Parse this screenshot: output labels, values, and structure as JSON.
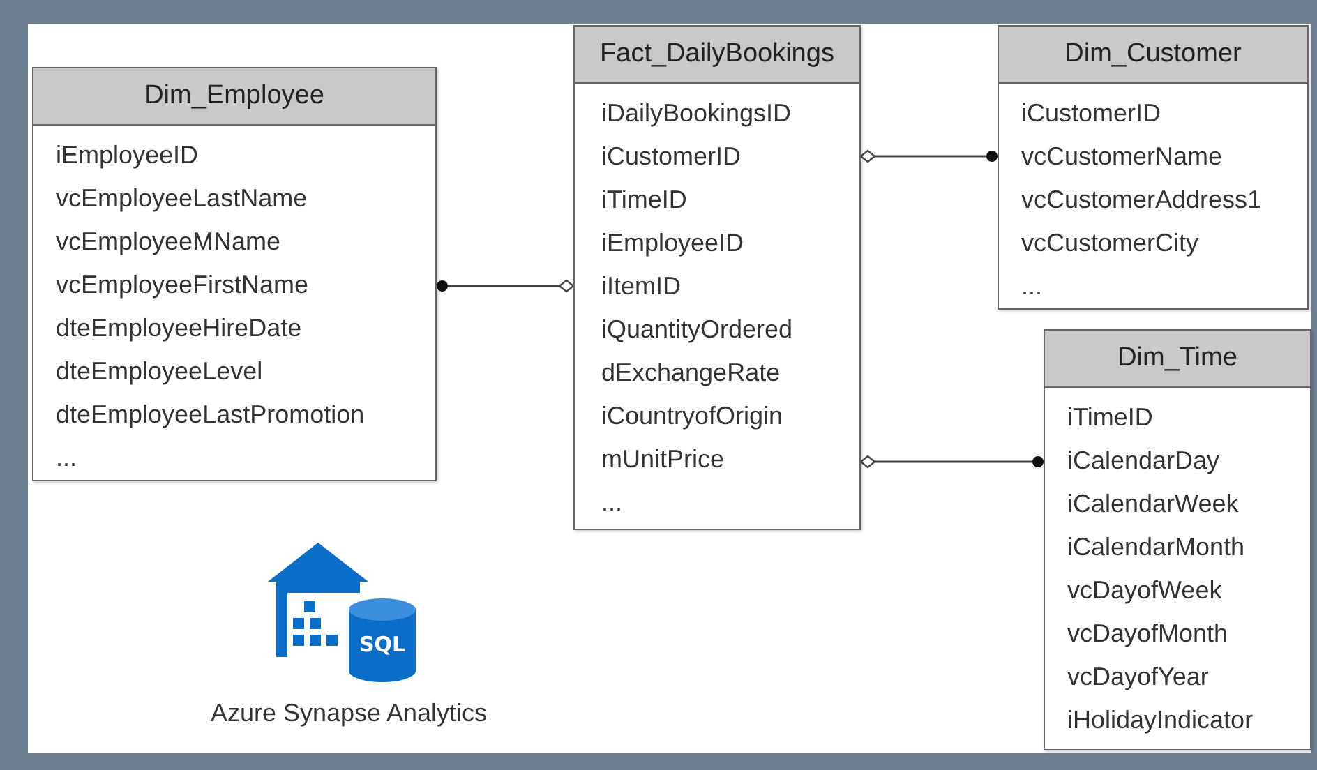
{
  "tables": [
    {
      "name": "Dim_Employee",
      "fields": [
        "iEmployeeID",
        "vcEmployeeLastName",
        "vcEmployeeMName",
        "vcEmployeeFirstName",
        "dteEmployeeHireDate",
        "dteEmployeeLevel",
        "dteEmployeeLastPromotion",
        "..."
      ]
    },
    {
      "name": "Fact_DailyBookings",
      "fields": [
        "iDailyBookingsID",
        "iCustomerID",
        "iTimeID",
        "iEmployeeID",
        "iItemID",
        "iQuantityOrdered",
        "dExchangeRate",
        "iCountryofOrigin",
        "mUnitPrice",
        "..."
      ]
    },
    {
      "name": "Dim_Customer",
      "fields": [
        "iCustomerID",
        "vcCustomerName",
        "vcCustomerAddress1",
        "vcCustomerCity",
        "..."
      ]
    },
    {
      "name": "Dim_Time",
      "fields": [
        "iTimeID",
        "iCalendarDay",
        "iCalendarWeek",
        "iCalendarMonth",
        "vcDayofWeek",
        "vcDayofMonth",
        "vcDayofYear",
        "iHolidayIndicator"
      ]
    }
  ],
  "logo": {
    "badge": "SQL",
    "caption": "Azure Synapse Analytics"
  }
}
